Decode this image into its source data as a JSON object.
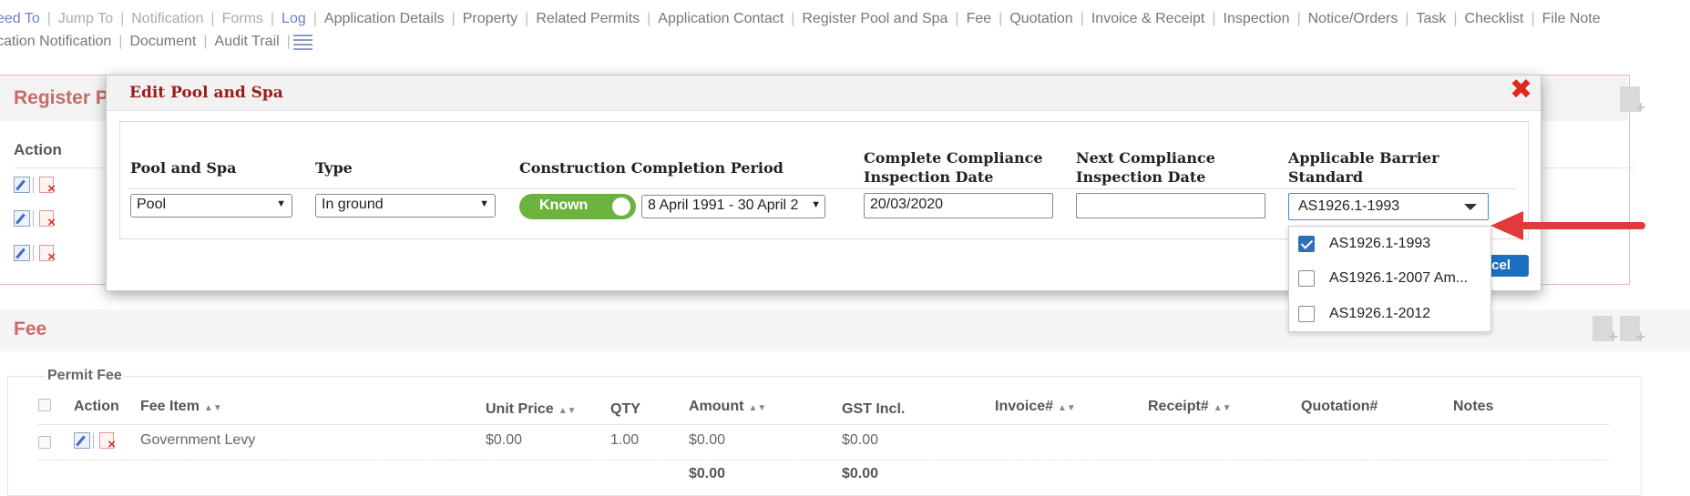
{
  "nav": {
    "row1": [
      "eed To",
      "Jump To",
      "Notification",
      "Forms",
      "Log",
      "Application Details",
      "Property",
      "Related Permits",
      "Application Contact",
      "Register Pool and Spa",
      "Fee",
      "Quotation",
      "Invoice & Receipt",
      "Inspection",
      "Notice/Orders",
      "Task",
      "Checklist",
      "File Note"
    ],
    "row2": [
      "cation Notification",
      "Document",
      "Audit Trail"
    ]
  },
  "register": {
    "title": "Register P",
    "action_label": "Action"
  },
  "fee": {
    "title": "Fee",
    "permit_label": "Permit Fee",
    "headers": {
      "action": "Action",
      "fee_item": "Fee Item",
      "unit_price": "Unit Price",
      "qty": "QTY",
      "amount": "Amount",
      "gst": "GST Incl.",
      "invoice": "Invoice#",
      "receipt": "Receipt#",
      "quotation": "Quotation#",
      "notes": "Notes"
    },
    "rows": [
      {
        "fee_item": "Government Levy",
        "unit_price": "$0.00",
        "qty": "1.00",
        "amount": "$0.00",
        "gst": "$0.00"
      }
    ],
    "totals": {
      "amount": "$0.00",
      "gst": "$0.00"
    }
  },
  "modal": {
    "title": "Edit Pool and Spa",
    "close_symbol": "✖",
    "columns": {
      "pool_spa": "Pool and Spa",
      "type": "Type",
      "construction": "Construction Completion Period",
      "complete_line1": "Complete Compliance",
      "complete_line2": "Inspection Date",
      "next_line1": "Next Compliance",
      "next_line2": "Inspection Date",
      "barrier_line1": "Applicable Barrier",
      "barrier_line2": "Standard"
    },
    "fields": {
      "pool_spa": "Pool",
      "type": "In ground",
      "toggle": "Known",
      "period": "8 April 1991 - 30 April 2",
      "complete_date": "20/03/2020",
      "next_date": "",
      "barrier": "AS1926.1-1993"
    },
    "cancel_label": "ncel"
  },
  "dropdown": {
    "options": [
      {
        "label": "AS1926.1-1993",
        "checked": true
      },
      {
        "label": "AS1926.1-2007 Am...",
        "checked": false
      },
      {
        "label": "AS1926.1-2012",
        "checked": false
      }
    ]
  },
  "colors": {
    "accent": "#c96a6a",
    "modal_title": "#9b1b1b",
    "toggle": "#6cb33e",
    "arrow": "#e03a3a",
    "primary": "#1d6fc0"
  }
}
